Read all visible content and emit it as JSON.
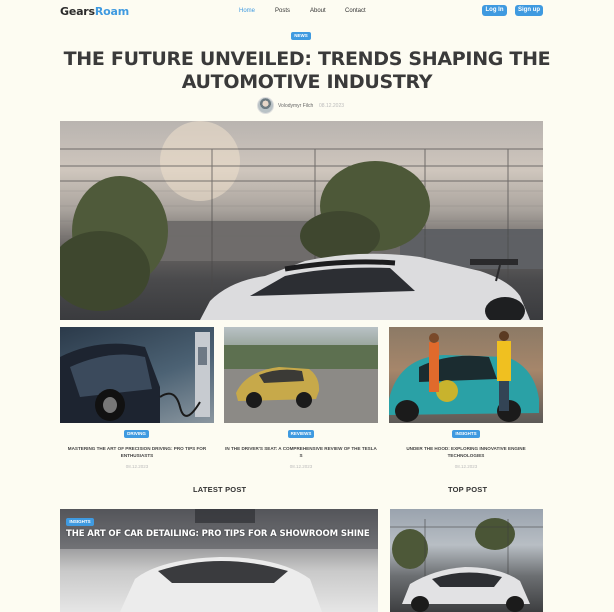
{
  "site": {
    "logo_part1": "Gears",
    "logo_part2": "Roam",
    "accent_color": "#3f9ae0"
  },
  "nav": {
    "links": [
      "Home",
      "Posts",
      "About",
      "Contact"
    ],
    "active": "Home",
    "login_label": "Log In",
    "signup_label": "Sign up"
  },
  "article": {
    "category": "NEWS",
    "title": "THE FUTURE UNVEILED: TRENDS SHAPING THE AUTOMOTIVE INDUSTRY",
    "author": "Volodymyr Filch",
    "date": "08.12.2023"
  },
  "cards": [
    {
      "category": "DRIVING",
      "title": "MASTERING THE ART OF PRECISION DRIVING: PRO TIPS FOR ENTHUSIASTS",
      "date": "08.12.2023"
    },
    {
      "category": "REVIEWS",
      "title": "IN THE DRIVER'S SEAT: A COMPREHENSIVE REVIEW OF THE TESLA S",
      "date": "08.12.2023"
    },
    {
      "category": "INSIGHTS",
      "title": "UNDER THE HOOD: EXPLORING INNOVATIVE ENGINE TECHNOLOGIES",
      "date": "08.12.2023"
    }
  ],
  "sections": {
    "latest_label": "LATEST POST",
    "top_label": "TOP POST"
  },
  "latest_post": {
    "category": "INSIGHTS",
    "title": "THE ART OF CAR DETAILING: PRO TIPS FOR A SHOWROOM SHINE"
  }
}
